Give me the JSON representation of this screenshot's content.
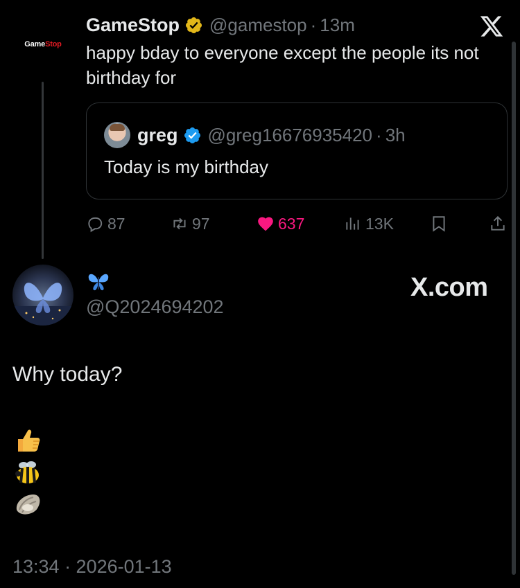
{
  "parent_tweet": {
    "avatar_logo_part1": "Game",
    "avatar_logo_part2": "Stop",
    "display_name": "GameStop",
    "handle": "@gamestop",
    "separator": "·",
    "time": "13m",
    "text": "happy bday to everyone except the people its not birthday for",
    "verified_badge_color": "#e2b719",
    "quote": {
      "display_name": "greg",
      "handle": "@greg16676935420",
      "separator": "·",
      "time": "3h",
      "text": "Today is my birthday",
      "verified_badge_color": "#1d9bf0"
    },
    "actions": {
      "replies": "87",
      "reposts": "97",
      "likes": "637",
      "views": "13K",
      "like_color": "#f91880"
    }
  },
  "reply": {
    "display_name_icon": "butterfly-icon",
    "handle": "@Q2024694202",
    "text": "Why today?",
    "emojis": [
      "thumbs-up-icon",
      "bee-icon",
      "oyster-icon"
    ],
    "timestamp": "13:34 · 2026-01-13"
  },
  "watermark": "X.com",
  "icons": [
    "x-logo-icon",
    "reply-icon",
    "repost-icon",
    "heart-icon",
    "views-icon",
    "bookmark-icon",
    "share-icon"
  ]
}
